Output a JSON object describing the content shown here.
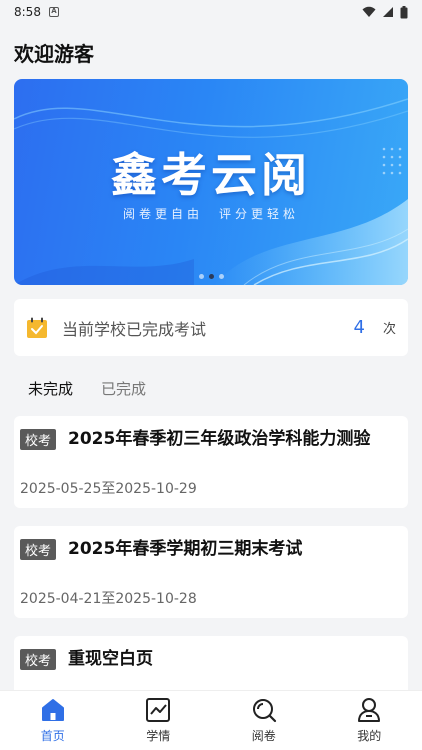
{
  "status_bar": {
    "time": "8:58",
    "sim": "A"
  },
  "header": {
    "title": "欢迎游客"
  },
  "banner": {
    "title": "鑫考云阅",
    "subtitle": "阅卷更自由　评分更轻松",
    "slides": 3,
    "active_slide": 2
  },
  "count_card": {
    "label": "当前学校已完成考试",
    "count": "4",
    "unit": "次"
  },
  "tabs": [
    {
      "label": "未完成",
      "active": true
    },
    {
      "label": "已完成",
      "active": false
    }
  ],
  "exams": [
    {
      "badge": "校考",
      "title": "2025年春季初三年级政治学科能力测验",
      "date": "2025-05-25至2025-10-29"
    },
    {
      "badge": "校考",
      "title": "2025年春季学期初三期末考试",
      "date": "2025-04-21至2025-10-28"
    },
    {
      "badge": "校考",
      "title": "重现空白页",
      "date": ""
    }
  ],
  "bottom_nav": [
    {
      "label": "首页",
      "icon": "home-icon",
      "active": true
    },
    {
      "label": "学情",
      "icon": "chart-icon",
      "active": false
    },
    {
      "label": "阅卷",
      "icon": "search-icon",
      "active": false
    },
    {
      "label": "我的",
      "icon": "user-icon",
      "active": false
    }
  ],
  "colors": {
    "accent": "#2f6fe6",
    "badge": "#5a5a5a",
    "background": "#f3f4f6"
  }
}
